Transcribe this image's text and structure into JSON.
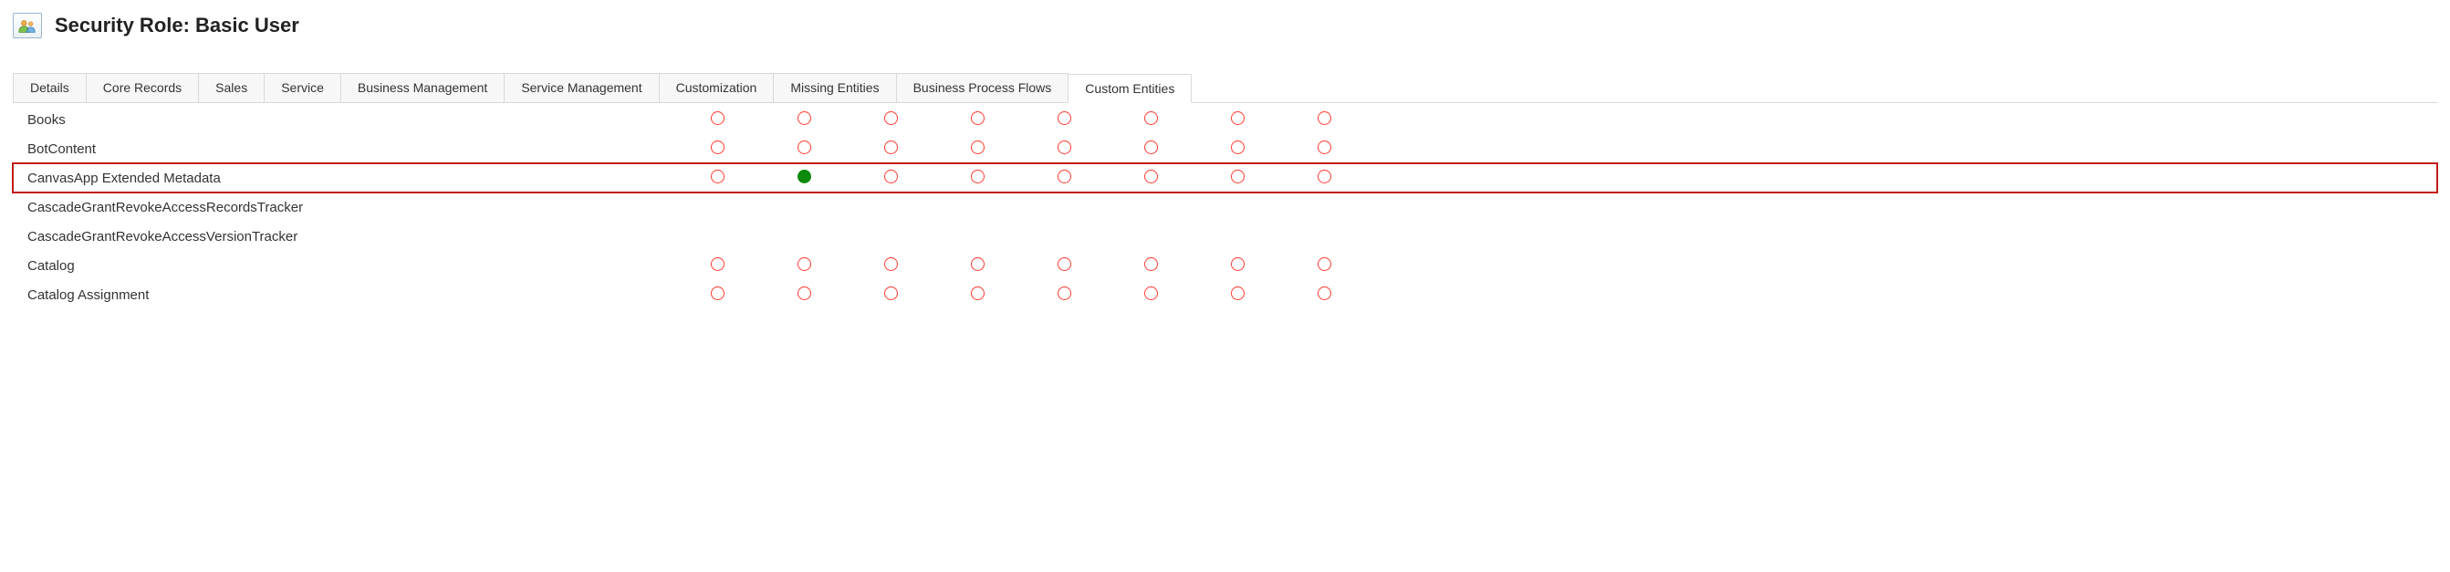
{
  "header": {
    "title": "Security Role: Basic User"
  },
  "tabs": [
    {
      "label": "Details",
      "active": false
    },
    {
      "label": "Core Records",
      "active": false
    },
    {
      "label": "Sales",
      "active": false
    },
    {
      "label": "Service",
      "active": false
    },
    {
      "label": "Business Management",
      "active": false
    },
    {
      "label": "Service Management",
      "active": false
    },
    {
      "label": "Customization",
      "active": false
    },
    {
      "label": "Missing Entities",
      "active": false
    },
    {
      "label": "Business Process Flows",
      "active": false
    },
    {
      "label": "Custom Entities",
      "active": true
    }
  ],
  "entities": [
    {
      "name": "Books",
      "highlight": false,
      "perms": [
        "none",
        "none",
        "none",
        "none",
        "none",
        "none",
        "none",
        "none"
      ]
    },
    {
      "name": "BotContent",
      "highlight": false,
      "perms": [
        "none",
        "none",
        "none",
        "none",
        "none",
        "none",
        "none",
        "none"
      ]
    },
    {
      "name": "CanvasApp Extended Metadata",
      "highlight": true,
      "perms": [
        "none",
        "full",
        "none",
        "none",
        "none",
        "none",
        "none",
        "none"
      ]
    },
    {
      "name": "CascadeGrantRevokeAccessRecordsTracker",
      "highlight": false,
      "perms": [
        "",
        "",
        "",
        "",
        "",
        "",
        "",
        ""
      ]
    },
    {
      "name": "CascadeGrantRevokeAccessVersionTracker",
      "highlight": false,
      "perms": [
        "",
        "",
        "",
        "",
        "",
        "",
        "",
        ""
      ]
    },
    {
      "name": "Catalog",
      "highlight": false,
      "perms": [
        "none",
        "none",
        "none",
        "none",
        "none",
        "none",
        "none",
        "none"
      ]
    },
    {
      "name": "Catalog Assignment",
      "highlight": false,
      "perms": [
        "none",
        "none",
        "none",
        "none",
        "none",
        "none",
        "none",
        "none"
      ]
    }
  ]
}
